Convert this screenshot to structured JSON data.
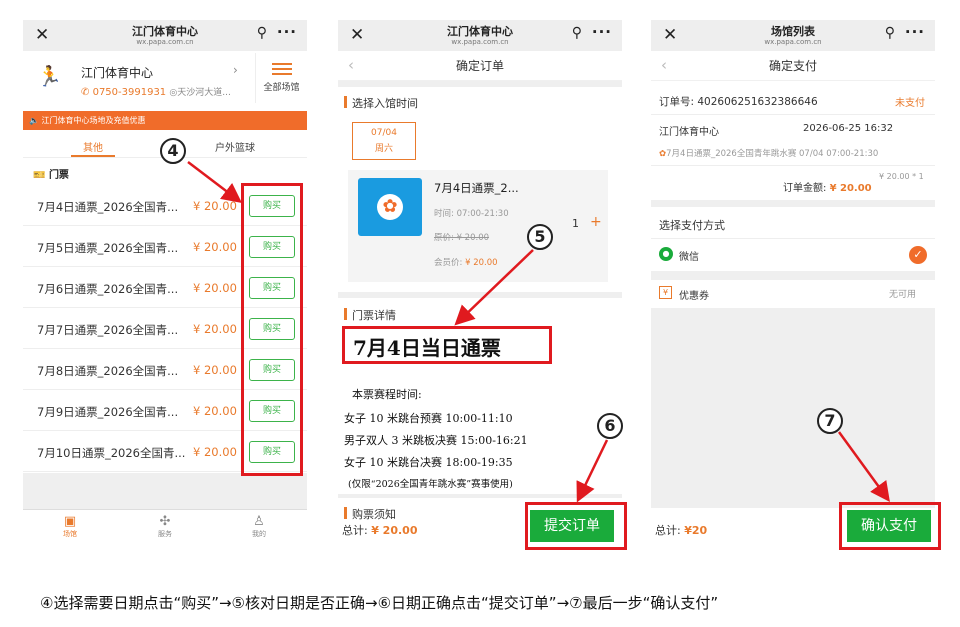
{
  "screen1": {
    "nav_title": "江门体育中心",
    "nav_url": "wx.papa.com.cn",
    "venue_name": "江门体育中心",
    "venue_phone": "0750-3991931",
    "venue_address": "天沙河大道...",
    "all_venues": "全部场馆",
    "notice": "江门体育中心场地及充值优惠",
    "tabs": [
      "其他",
      "户外篮球"
    ],
    "section": "门票",
    "buy_label": "购买",
    "tickets": [
      {
        "name": "7月4日通票_2026全国青...",
        "price": "¥ 20.00"
      },
      {
        "name": "7月5日通票_2026全国青...",
        "price": "¥ 20.00"
      },
      {
        "name": "7月6日通票_2026全国青...",
        "price": "¥ 20.00"
      },
      {
        "name": "7月7日通票_2026全国青...",
        "price": "¥ 20.00"
      },
      {
        "name": "7月8日通票_2026全国青...",
        "price": "¥ 20.00"
      },
      {
        "name": "7月9日通票_2026全国青...",
        "price": "¥ 20.00"
      },
      {
        "name": "7月10日通票_2026全国青...",
        "price": "¥ 20.00"
      }
    ],
    "tabbar": [
      "场馆",
      "服务",
      "我的"
    ]
  },
  "screen2": {
    "nav_title": "江门体育中心",
    "nav_url": "wx.papa.com.cn",
    "page_title": "确定订单",
    "entry_time_label": "选择入馆时间",
    "date": "07/04",
    "weekday": "周六",
    "product_name": "7月4日通票_2...",
    "time": "时间: 07:00-21:30",
    "original_price": "原价: ¥ 20.00",
    "member_price_label": "会员价: ",
    "member_price": "¥ 20.00",
    "qty": "1",
    "details_label": "门票详情",
    "big_title": "7月4日当日通票",
    "schedule_title": "本票赛程时间:",
    "schedule": [
      "女子 10 米跳台预赛   10:00-11:10",
      "男子双人 3 米跳板决赛 15:00-16:21",
      "女子 10 米跳台决赛   18:00-19:35",
      "(仅限“2026全国青年跳水赛”赛事使用)"
    ],
    "notice_label": "购票须知",
    "total_label": "总计: ",
    "total": "¥ 20.00",
    "submit": "提交订单"
  },
  "screen3": {
    "nav_title": "场馆列表",
    "nav_url": "wx.papa.com.cn",
    "page_title": "确定支付",
    "order_no": "订单号: 402606251632386646",
    "unpaid": "未支付",
    "venue": "江门体育中心",
    "datetime": "2026-06-25 16:32",
    "item": "7月4日通票_2026全国青年跳水赛 07/04 07:00-21:30",
    "amount_label": "订单金额: ",
    "amount": "¥ 20.00",
    "amount_note": "¥ 20.00 * 1",
    "pay_method_label": "选择支付方式",
    "wechat": "微信",
    "coupon": "优惠券",
    "coupon_status": "无可用",
    "total_label": "总计: ",
    "total": "¥20",
    "confirm": "确认支付"
  },
  "steps": [
    "4",
    "5",
    "6",
    "7"
  ],
  "caption": "④选择需要日期点击“购买”→⑤核对日期是否正确→⑥日期正确点击“提交订单”→⑦最后一步“确认支付”",
  "colors": {
    "accent": "#e97a2c",
    "green": "#3cb34a",
    "red": "#e01a1f"
  }
}
